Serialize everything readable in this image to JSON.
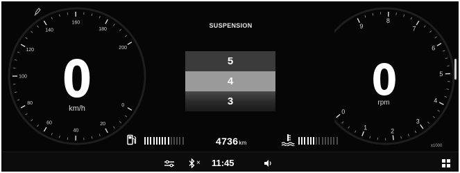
{
  "title": "SUSPENSION",
  "speedometer": {
    "value": "0",
    "unit": "km/h",
    "ticks": [
      "0",
      "20",
      "40",
      "60",
      "80",
      "100",
      "120",
      "140",
      "160",
      "180",
      "200"
    ]
  },
  "tachometer": {
    "value": "0",
    "unit": "rpm",
    "scale_label": "x1000",
    "ticks": [
      "0",
      "1",
      "2",
      "3",
      "4",
      "5",
      "6",
      "7",
      "8",
      "9"
    ]
  },
  "suspension_selector": {
    "options": [
      "5",
      "4",
      "3"
    ],
    "selected": "4"
  },
  "fuel": {
    "segments": 14,
    "filled": 9
  },
  "odometer": {
    "value": "4736",
    "unit": "km"
  },
  "coolant": {
    "segments": 14,
    "filled": 6
  },
  "status_bar": {
    "time": "11:45",
    "bluetooth_status": "×"
  },
  "icons": [
    "pen-icon",
    "fuel-icon",
    "coolant-temp-icon",
    "settings-sliders-icon",
    "bluetooth-icon",
    "volume-icon",
    "grid-menu-icon"
  ],
  "colors": {
    "background": "#060606",
    "selected_highlight": "#9a9a9a",
    "text": "#ffffff"
  }
}
